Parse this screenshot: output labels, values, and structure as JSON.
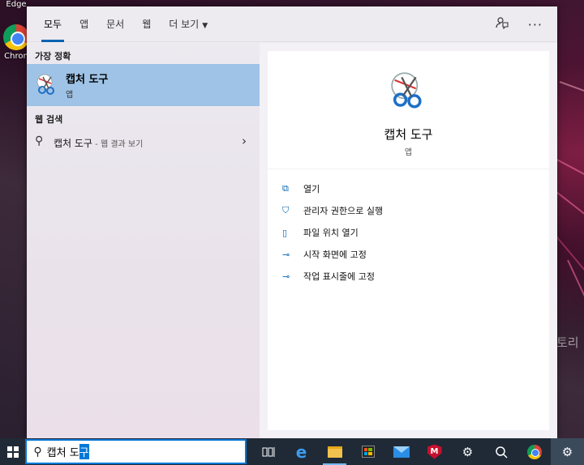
{
  "desktop": {
    "icons": [
      {
        "label": "Edge"
      },
      {
        "label": "Chron"
      }
    ],
    "right_text": "토리"
  },
  "search_panel": {
    "tabs": [
      {
        "label": "모두",
        "active": true
      },
      {
        "label": "앱"
      },
      {
        "label": "문서"
      },
      {
        "label": "웹"
      },
      {
        "label": "더 보기"
      }
    ],
    "best_match": {
      "section_title": "가장 정확",
      "name": "캡처 도구",
      "type": "앱"
    },
    "web_search": {
      "section_title": "웹 검색",
      "query": "캡처 도구",
      "suffix": " - 웹 결과 보기"
    },
    "detail": {
      "name": "캡처 도구",
      "type": "앱",
      "actions": [
        {
          "label": "열기",
          "icon": "open-icon"
        },
        {
          "label": "관리자 권한으로 실행",
          "icon": "shield-icon"
        },
        {
          "label": "파일 위치 열기",
          "icon": "file-location-icon"
        },
        {
          "label": "시작 화면에 고정",
          "icon": "pin-icon"
        },
        {
          "label": "작업 표시줄에 고정",
          "icon": "pin-icon"
        }
      ]
    }
  },
  "taskbar": {
    "search_text": "캡처 도",
    "search_selected": "구",
    "icons": [
      "task-view-icon",
      "edge-icon",
      "file-explorer-icon",
      "store-icon",
      "mail-icon",
      "mcafee-icon",
      "settings-icon",
      "feedback-icon",
      "chrome-icon",
      "gear-icon"
    ]
  },
  "colors": {
    "accent": "#0078d7",
    "selected_row": "#9fc3e6"
  }
}
